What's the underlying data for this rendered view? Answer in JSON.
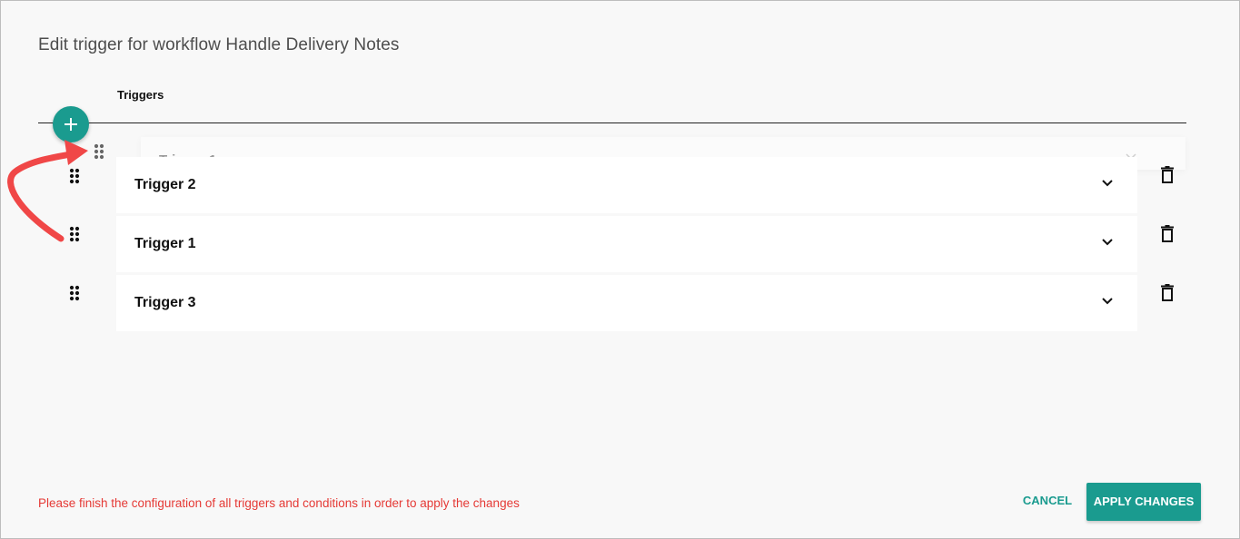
{
  "dialog": {
    "title": "Edit trigger for workflow Handle Delivery Notes",
    "section_label": "Triggers"
  },
  "add_button": {
    "icon": "plus-icon"
  },
  "dragging": {
    "label": "Trigger 1"
  },
  "triggers": [
    {
      "label": "Trigger 2"
    },
    {
      "label": "Trigger 1"
    },
    {
      "label": "Trigger 3"
    }
  ],
  "footer": {
    "error": "Please finish the configuration of all triggers and conditions in order to apply the changes",
    "cancel_label": "CANCEL",
    "apply_label": "APPLY CHANGES"
  },
  "colors": {
    "accent": "#1a9b8f",
    "error": "#e53935",
    "annotation_arrow": "#f04747"
  }
}
